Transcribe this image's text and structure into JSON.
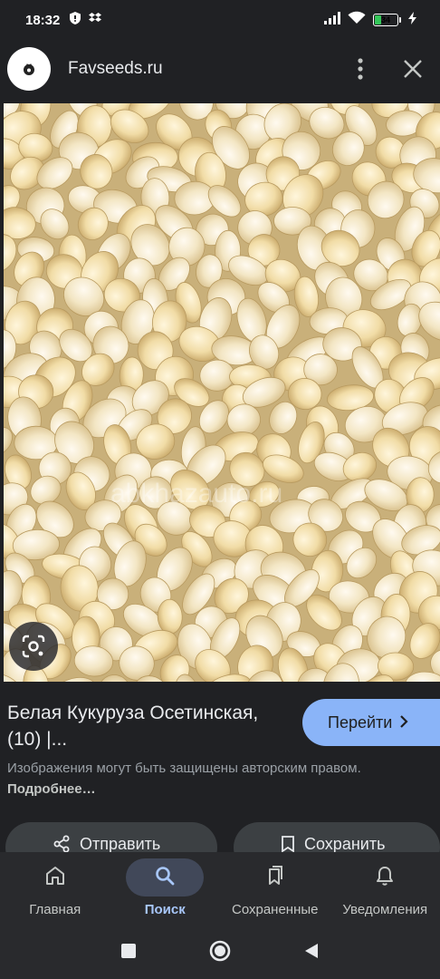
{
  "status_bar": {
    "time": "18:32",
    "battery_level": "34",
    "icons": [
      "shield-icon",
      "dropbox-icon",
      "signal-icon",
      "wifi-icon",
      "battery-icon",
      "charging-icon"
    ]
  },
  "header": {
    "site_name": "Favseeds.ru",
    "icons": [
      "site-logo",
      "more-vert-icon",
      "close-icon"
    ]
  },
  "image": {
    "watermark": "abkhazauto.ru",
    "lens_icon": "google-lens-icon"
  },
  "result": {
    "title": "Белая Кукуруза Осетинская, (10) |...",
    "visit_label": "Перейти",
    "copyright_text": "Изображения могут быть защищены авторским правом.",
    "learn_more": "Подробнее…"
  },
  "actions": {
    "share_label": "Отправить",
    "save_label": "Сохранить"
  },
  "bottom_nav": {
    "items": [
      {
        "label": "Главная",
        "icon": "home-icon",
        "active": false
      },
      {
        "label": "Поиск",
        "icon": "search-icon",
        "active": true
      },
      {
        "label": "Сохраненные",
        "icon": "collections-icon",
        "active": false
      },
      {
        "label": "Уведомления",
        "icon": "bell-icon",
        "active": false
      }
    ]
  },
  "colors": {
    "background": "#202124",
    "accent": "#8ab4f8",
    "active_nav": "#a8c7fa",
    "battery": "#34c759"
  }
}
